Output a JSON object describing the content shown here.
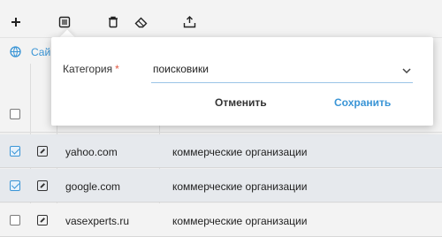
{
  "toolbar": {
    "icons": [
      "plus-icon",
      "list-icon",
      "trash-icon",
      "eraser-icon",
      "upload-icon"
    ]
  },
  "breadcrumb": {
    "label": "Сай"
  },
  "dialog": {
    "field_label": "Категория",
    "required_mark": "*",
    "select_value": "поисковики",
    "cancel_label": "Отменить",
    "save_label": "Сохранить"
  },
  "rows": [
    {
      "domain": "yahoo.com",
      "category": "коммерческие организации",
      "checked": true
    },
    {
      "domain": "google.com",
      "category": "коммерческие организации",
      "checked": true
    },
    {
      "domain": "vasexperts.ru",
      "category": "коммерческие организации",
      "checked": false
    }
  ],
  "colors": {
    "accent": "#3a95d6",
    "required": "#e0563f",
    "selected_row": "#e6e9ed"
  }
}
